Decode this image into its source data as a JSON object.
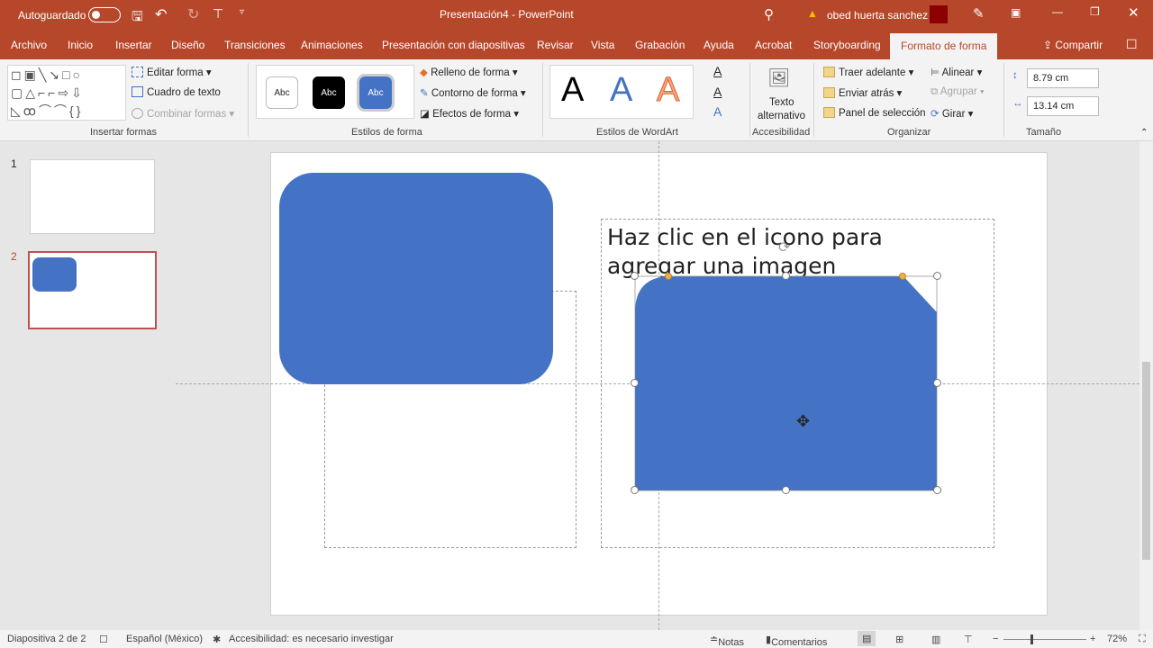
{
  "titlebar": {
    "autosave": "Autoguardado",
    "title": "Presentación4  -  PowerPoint",
    "user": "obed huerta sanchez"
  },
  "tabs": [
    "Archivo",
    "Inicio",
    "Insertar",
    "Diseño",
    "Transiciones",
    "Animaciones",
    "Presentación con diapositivas",
    "Revisar",
    "Vista",
    "Grabación",
    "Ayuda",
    "Acrobat",
    "Storyboarding",
    "Formato de forma"
  ],
  "share": "Compartir",
  "ribbon": {
    "insert_shapes": {
      "edit": "Editar forma",
      "textbox": "Cuadro de texto",
      "combine": "Combinar formas",
      "label": "Insertar formas"
    },
    "shape_styles": {
      "abc": "Abc",
      "fill": "Relleno de forma",
      "outline": "Contorno de forma",
      "effects": "Efectos de forma",
      "label": "Estilos de forma"
    },
    "wordart": {
      "letter": "A",
      "label": "Estilos de WordArt"
    },
    "accessibility": {
      "alt1": "Texto",
      "alt2": "alternativo",
      "label": "Accesibilidad"
    },
    "arrange": {
      "forward": "Traer adelante",
      "backward": "Enviar atrás",
      "pane": "Panel de selección",
      "align": "Alinear",
      "group": "Agrupar",
      "rotate": "Girar",
      "label": "Organizar"
    },
    "size": {
      "height": "8.79 cm",
      "width": "13.14 cm",
      "label": "Tamaño"
    }
  },
  "slides": [
    {
      "num": "1"
    },
    {
      "num": "2"
    }
  ],
  "slide": {
    "placeholder": "Haz clic en el icono para agregar una imagen",
    "shape_color": "#4472C4"
  },
  "status": {
    "slide": "Diapositiva 2 de 2",
    "lang": "Español (México)",
    "access": "Accesibilidad: es necesario investigar",
    "notes": "Notas",
    "comments": "Comentarios",
    "zoom": "72%"
  }
}
